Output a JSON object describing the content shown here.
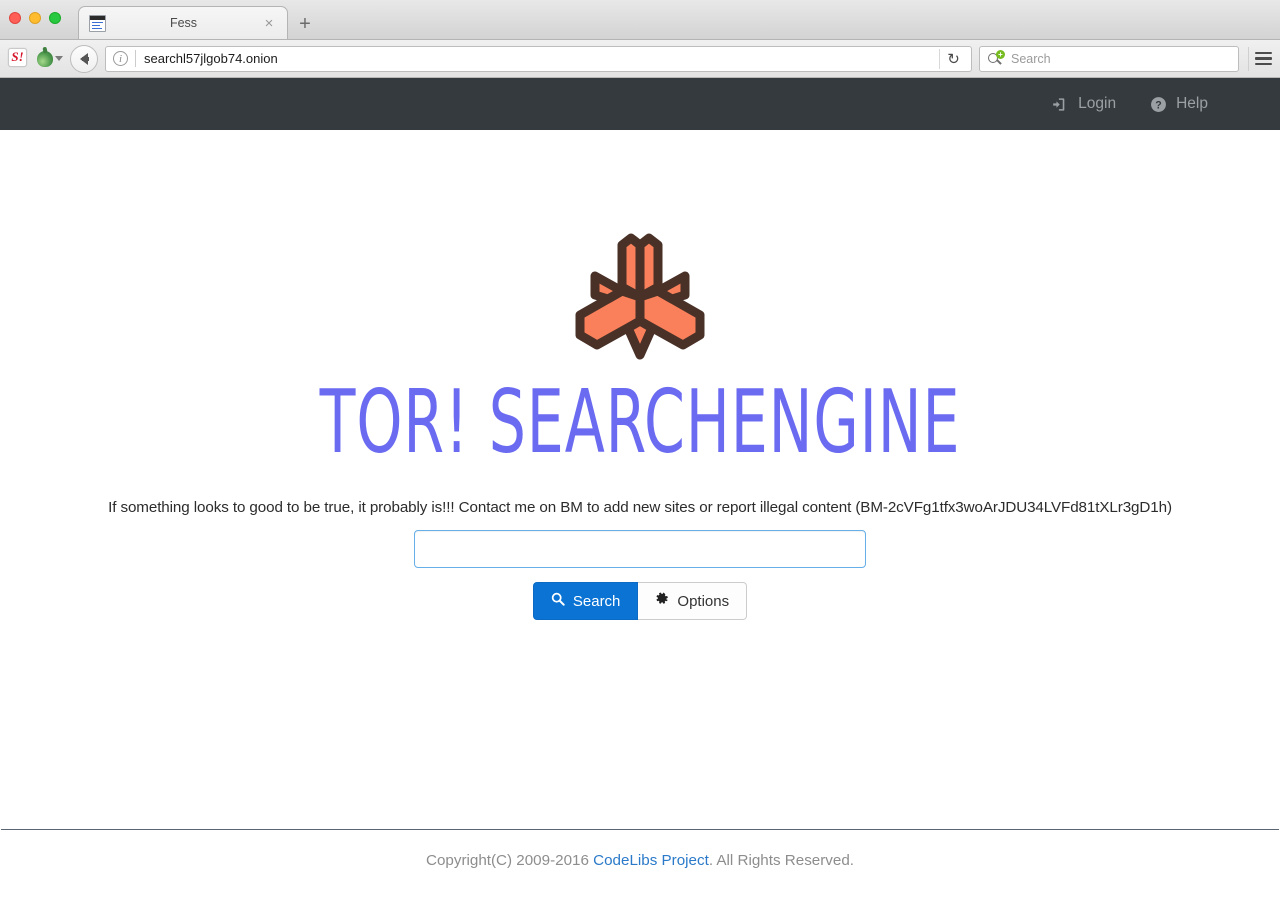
{
  "browser": {
    "tab": {
      "title": "Fess",
      "close_label": "×"
    },
    "new_tab_label": "+",
    "url": "searchl57jlgob74.onion",
    "reload_label": "↻",
    "search_placeholder": "Search",
    "s_icon_label": "S!",
    "info_icon_label": "i",
    "mag_badge_label": "+"
  },
  "topnav": {
    "links": [
      {
        "label": "Login",
        "icon": "sign-in-icon"
      },
      {
        "label": "Help",
        "icon": "question-circle-icon"
      }
    ]
  },
  "main": {
    "logo_alt": "tor-searchengine-logo",
    "brand": "TOR! SEARCHENGINE",
    "tagline": "If something looks to good to be true, it probably is!!! Contact me on BM to add new sites or report illegal content (BM-2cVFg1tfx3woArJDU34LVFd81tXLr3gD1h)",
    "search": {
      "value": "",
      "placeholder": ""
    },
    "buttons": {
      "search_label": "Search",
      "options_label": "Options"
    }
  },
  "footer": {
    "prefix": "Copyright(C) 2009-2016 ",
    "link": "CodeLibs Project",
    "suffix": ". All Rights Reserved."
  },
  "colors": {
    "navbar_bg": "#343a3d",
    "brand": "#6b6bf2",
    "logo_fill": "#f9805a",
    "logo_stroke": "#4a3127",
    "primary_button": "#0a73d4",
    "link": "#2a7ac9",
    "input_focus_border": "#66afe9"
  }
}
